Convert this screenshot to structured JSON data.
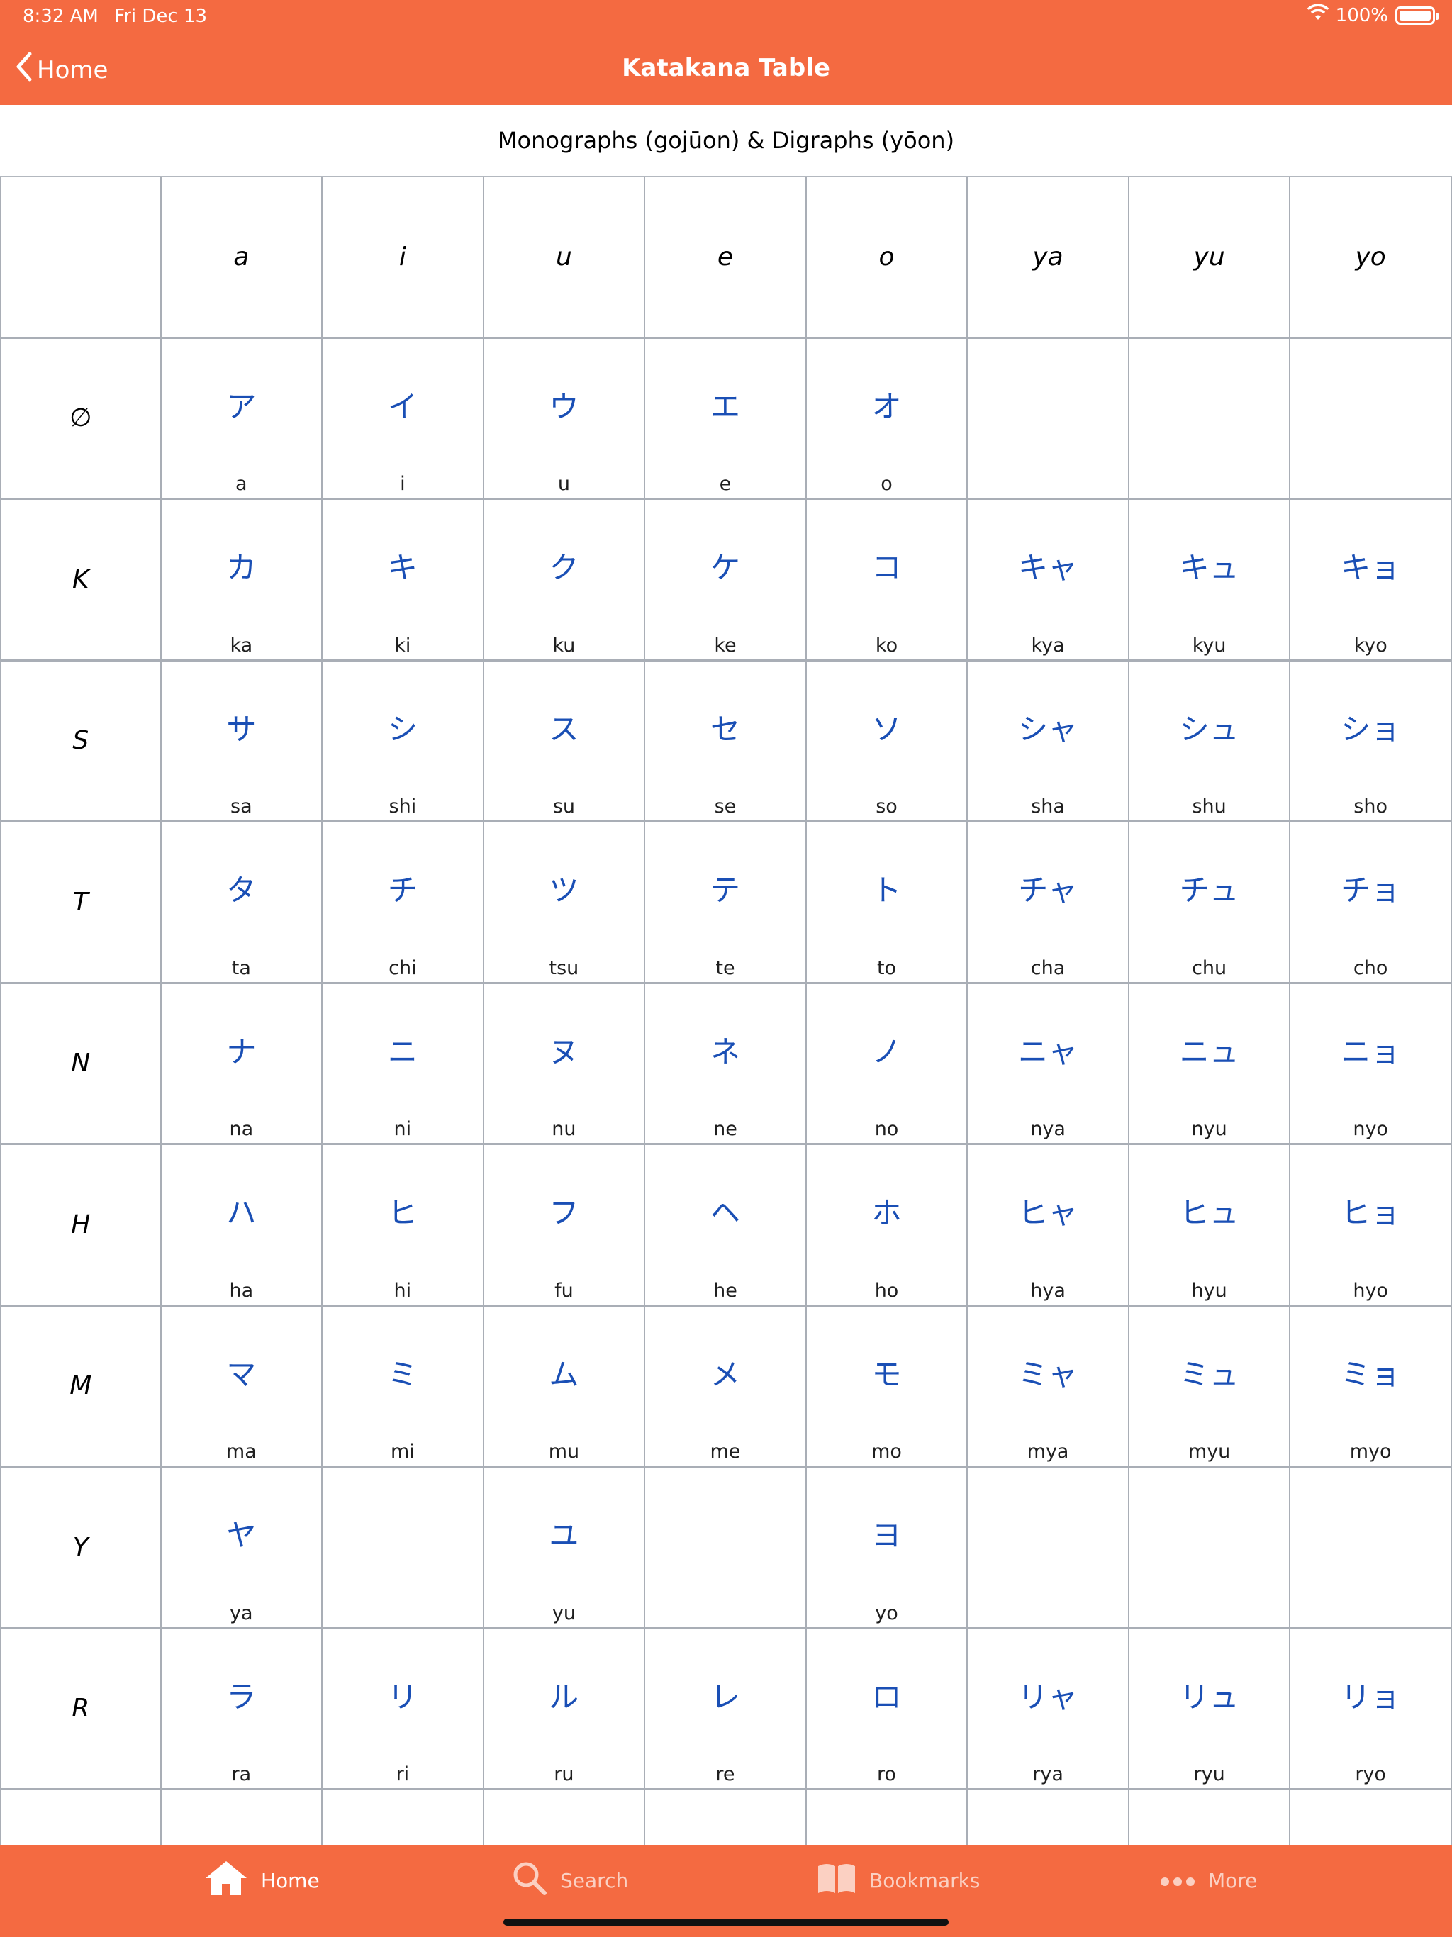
{
  "status": {
    "time": "8:32 AM",
    "date": "Fri Dec 13",
    "battery": "100%",
    "battery_level": 1.0
  },
  "nav": {
    "back_label": "Home",
    "title": "Katakana Table"
  },
  "subtitle": "Monographs (gojūon) & Digraphs (yōon)",
  "table": {
    "columns": [
      "a",
      "i",
      "u",
      "e",
      "o",
      "ya",
      "yu",
      "yo"
    ],
    "rows": [
      {
        "label": "∅",
        "cells": [
          {
            "kana": "ア",
            "romaji": "a"
          },
          {
            "kana": "イ",
            "romaji": "i"
          },
          {
            "kana": "ウ",
            "romaji": "u"
          },
          {
            "kana": "エ",
            "romaji": "e"
          },
          {
            "kana": "オ",
            "romaji": "o"
          },
          null,
          null,
          null
        ]
      },
      {
        "label": "K",
        "cells": [
          {
            "kana": "カ",
            "romaji": "ka"
          },
          {
            "kana": "キ",
            "romaji": "ki"
          },
          {
            "kana": "ク",
            "romaji": "ku"
          },
          {
            "kana": "ケ",
            "romaji": "ke"
          },
          {
            "kana": "コ",
            "romaji": "ko"
          },
          {
            "kana": "キャ",
            "romaji": "kya"
          },
          {
            "kana": "キュ",
            "romaji": "kyu"
          },
          {
            "kana": "キョ",
            "romaji": "kyo"
          }
        ]
      },
      {
        "label": "S",
        "cells": [
          {
            "kana": "サ",
            "romaji": "sa"
          },
          {
            "kana": "シ",
            "romaji": "shi"
          },
          {
            "kana": "ス",
            "romaji": "su"
          },
          {
            "kana": "セ",
            "romaji": "se"
          },
          {
            "kana": "ソ",
            "romaji": "so"
          },
          {
            "kana": "シャ",
            "romaji": "sha"
          },
          {
            "kana": "シュ",
            "romaji": "shu"
          },
          {
            "kana": "ショ",
            "romaji": "sho"
          }
        ]
      },
      {
        "label": "T",
        "cells": [
          {
            "kana": "タ",
            "romaji": "ta"
          },
          {
            "kana": "チ",
            "romaji": "chi"
          },
          {
            "kana": "ツ",
            "romaji": "tsu"
          },
          {
            "kana": "テ",
            "romaji": "te"
          },
          {
            "kana": "ト",
            "romaji": "to"
          },
          {
            "kana": "チャ",
            "romaji": "cha"
          },
          {
            "kana": "チュ",
            "romaji": "chu"
          },
          {
            "kana": "チョ",
            "romaji": "cho"
          }
        ]
      },
      {
        "label": "N",
        "cells": [
          {
            "kana": "ナ",
            "romaji": "na"
          },
          {
            "kana": "ニ",
            "romaji": "ni"
          },
          {
            "kana": "ヌ",
            "romaji": "nu"
          },
          {
            "kana": "ネ",
            "romaji": "ne"
          },
          {
            "kana": "ノ",
            "romaji": "no"
          },
          {
            "kana": "ニャ",
            "romaji": "nya"
          },
          {
            "kana": "ニュ",
            "romaji": "nyu"
          },
          {
            "kana": "ニョ",
            "romaji": "nyo"
          }
        ]
      },
      {
        "label": "H",
        "cells": [
          {
            "kana": "ハ",
            "romaji": "ha"
          },
          {
            "kana": "ヒ",
            "romaji": "hi"
          },
          {
            "kana": "フ",
            "romaji": "fu"
          },
          {
            "kana": "ヘ",
            "romaji": "he"
          },
          {
            "kana": "ホ",
            "romaji": "ho"
          },
          {
            "kana": "ヒャ",
            "romaji": "hya"
          },
          {
            "kana": "ヒュ",
            "romaji": "hyu"
          },
          {
            "kana": "ヒョ",
            "romaji": "hyo"
          }
        ]
      },
      {
        "label": "M",
        "cells": [
          {
            "kana": "マ",
            "romaji": "ma"
          },
          {
            "kana": "ミ",
            "romaji": "mi"
          },
          {
            "kana": "ム",
            "romaji": "mu"
          },
          {
            "kana": "メ",
            "romaji": "me"
          },
          {
            "kana": "モ",
            "romaji": "mo"
          },
          {
            "kana": "ミャ",
            "romaji": "mya"
          },
          {
            "kana": "ミュ",
            "romaji": "myu"
          },
          {
            "kana": "ミョ",
            "romaji": "myo"
          }
        ]
      },
      {
        "label": "Y",
        "cells": [
          {
            "kana": "ヤ",
            "romaji": "ya"
          },
          null,
          {
            "kana": "ユ",
            "romaji": "yu"
          },
          null,
          {
            "kana": "ヨ",
            "romaji": "yo"
          },
          null,
          null,
          null
        ]
      },
      {
        "label": "R",
        "cells": [
          {
            "kana": "ラ",
            "romaji": "ra"
          },
          {
            "kana": "リ",
            "romaji": "ri"
          },
          {
            "kana": "ル",
            "romaji": "ru"
          },
          {
            "kana": "レ",
            "romaji": "re"
          },
          {
            "kana": "ロ",
            "romaji": "ro"
          },
          {
            "kana": "リャ",
            "romaji": "rya"
          },
          {
            "kana": "リュ",
            "romaji": "ryu"
          },
          {
            "kana": "リョ",
            "romaji": "ryo"
          }
        ]
      },
      {
        "label": "",
        "cells": [
          null,
          null,
          null,
          null,
          null,
          null,
          null,
          null
        ]
      }
    ]
  },
  "tabbar": {
    "items": [
      {
        "label": "Home",
        "icon": "home-icon",
        "active": true
      },
      {
        "label": "Search",
        "icon": "search-icon",
        "active": false
      },
      {
        "label": "Bookmarks",
        "icon": "book-icon",
        "active": false
      },
      {
        "label": "More",
        "icon": "more-icon",
        "active": false
      }
    ]
  },
  "colors": {
    "brand": "#f46a41",
    "kana": "#1a4fb5",
    "grid": "#a9aeb6"
  }
}
